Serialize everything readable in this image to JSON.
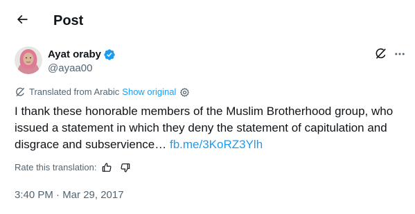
{
  "header": {
    "title": "Post",
    "back_icon": "arrow-left-icon"
  },
  "author": {
    "display_name": "Ayat oraby",
    "handle": "@ayaa00",
    "verified_icon": "verified-badge-icon",
    "verified_color": "#1d9bf0"
  },
  "actions": {
    "grok_icon": "grok-icon",
    "more_icon": "more-horizontal-icon"
  },
  "translation": {
    "label": "Translated from Arabic",
    "show_original": "Show original",
    "settings_icon": "gear-icon"
  },
  "post": {
    "text": "I thank these honorable members of the Muslim Brotherhood group, who issued a statement in which they deny the statement of capitulation and disgrace and subservience…",
    "link": "fb.me/3KoRZ3Ylh"
  },
  "rating": {
    "label": "Rate this translation:",
    "thumbs_up_icon": "thumbs-up-icon",
    "thumbs_down_icon": "thumbs-down-icon"
  },
  "timestamp": "3:40 PM · Mar 29, 2017",
  "colors": {
    "text_primary": "#0f1419",
    "text_secondary": "#536471",
    "accent": "#1d9bf0"
  }
}
